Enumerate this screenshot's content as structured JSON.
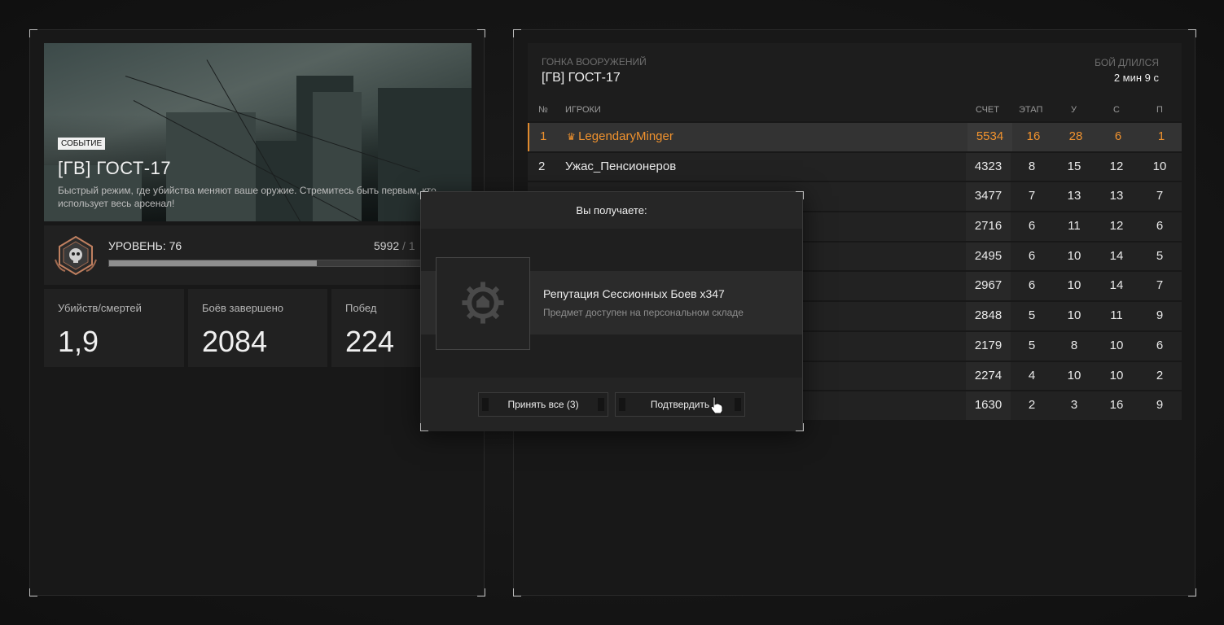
{
  "event": {
    "badge": "СОБЫТИЕ",
    "title": "[ГВ] ГОСТ-17",
    "description": "Быстрый режим, где убийства меняют ваше оружие. Стремитесь быть первым, кто использует весь арсенал!"
  },
  "level": {
    "label": "УРОВЕНЬ: 76",
    "xp_current": "5992",
    "xp_sep": "/ 1",
    "progress": 0.61
  },
  "stats": [
    {
      "label": "Убийств/смертей",
      "value": "1,9"
    },
    {
      "label": "Боёв завершено",
      "value": "2084"
    },
    {
      "label": "Побед",
      "value": "224"
    }
  ],
  "match": {
    "mode": "ГОНКА ВООРУЖЕНИЙ",
    "map": "[ГВ] ГОСТ-17",
    "duration_label": "БОЙ ДЛИЛСЯ",
    "duration": "2 мин 9 с",
    "headers": {
      "no": "№",
      "players": "ИГРОКИ",
      "score": "СЧЕТ",
      "stage": "ЭТАП",
      "kills": "У",
      "deaths": "С",
      "assists": "П"
    },
    "rows": [
      {
        "no": "1",
        "name": "LegendaryMinger",
        "score": "5534",
        "stage": "16",
        "kills": "28",
        "deaths": "6",
        "assists": "1",
        "me": true
      },
      {
        "no": "2",
        "name": "Ужас_Пенсионеров",
        "score": "4323",
        "stage": "8",
        "kills": "15",
        "deaths": "12",
        "assists": "10"
      },
      {
        "no": "",
        "name": "",
        "score": "3477",
        "stage": "7",
        "kills": "13",
        "deaths": "13",
        "assists": "7"
      },
      {
        "no": "",
        "name": "",
        "score": "2716",
        "stage": "6",
        "kills": "11",
        "deaths": "12",
        "assists": "6"
      },
      {
        "no": "",
        "name": "",
        "score": "2495",
        "stage": "6",
        "kills": "10",
        "deaths": "14",
        "assists": "5"
      },
      {
        "no": "",
        "name": "",
        "score": "2967",
        "stage": "6",
        "kills": "10",
        "deaths": "14",
        "assists": "7"
      },
      {
        "no": "",
        "name": "",
        "score": "2848",
        "stage": "5",
        "kills": "10",
        "deaths": "11",
        "assists": "9"
      },
      {
        "no": "",
        "name": "",
        "score": "2179",
        "stage": "5",
        "kills": "8",
        "deaths": "10",
        "assists": "6"
      },
      {
        "no": "",
        "name": "",
        "score": "2274",
        "stage": "4",
        "kills": "10",
        "deaths": "10",
        "assists": "2"
      },
      {
        "no": "",
        "name": "",
        "score": "1630",
        "stage": "2",
        "kills": "3",
        "deaths": "16",
        "assists": "9"
      }
    ]
  },
  "modal": {
    "title": "Вы получаете:",
    "reward_name": "Репутация Сессионных Боев х347",
    "reward_sub": "Предмет доступен на персональном складе",
    "accept_all": "Принять все (3)",
    "confirm": "Подтвердить"
  },
  "colors": {
    "accent": "#f0922e"
  },
  "icons": [
    "crown-icon",
    "skull-emblem-icon",
    "reputation-gear-icon",
    "hand-cursor-icon"
  ]
}
